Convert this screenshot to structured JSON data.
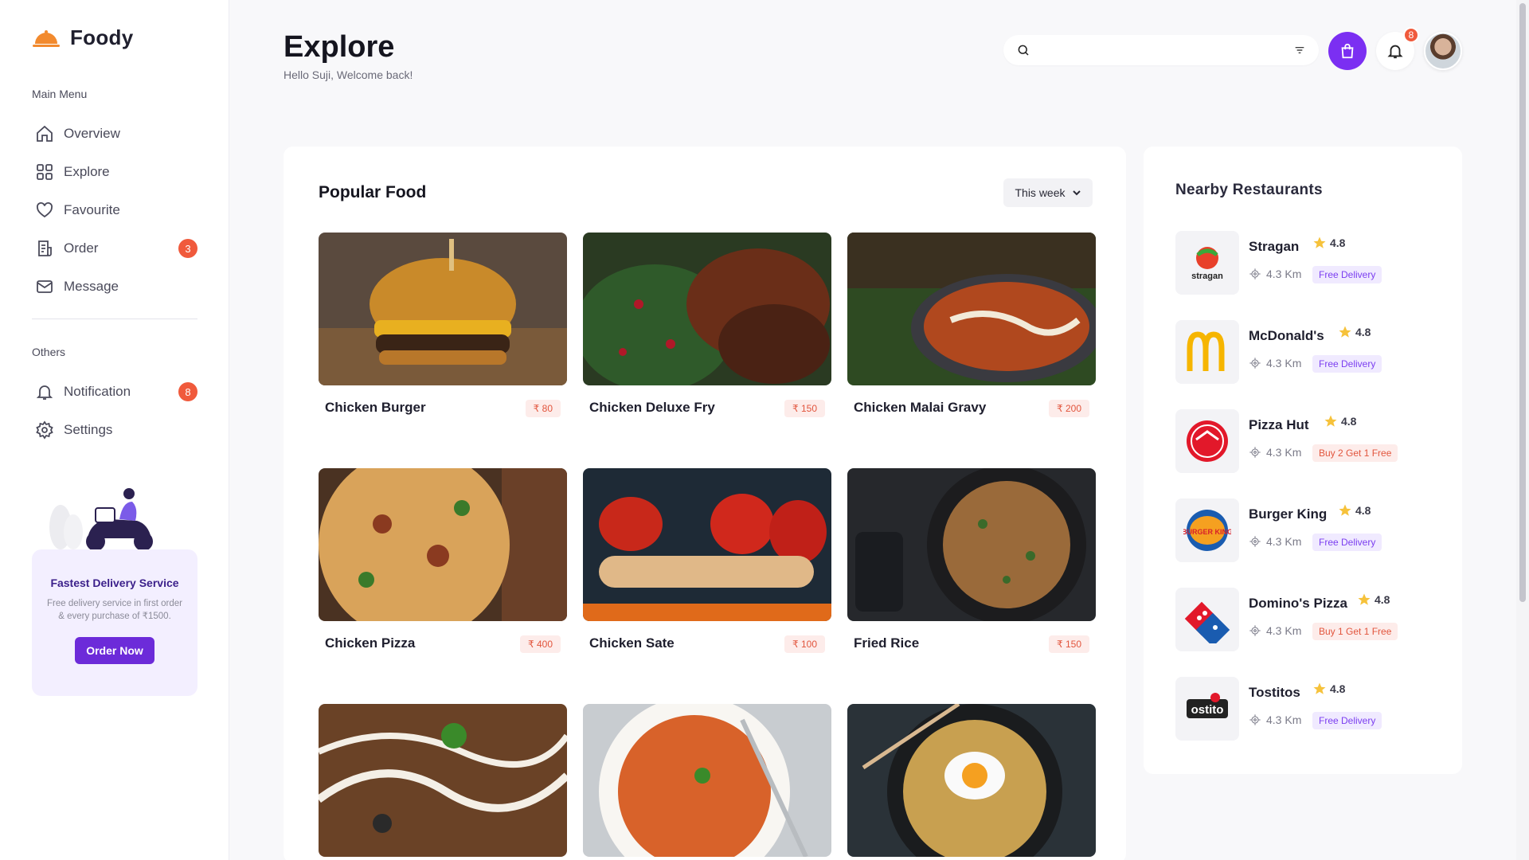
{
  "app": {
    "name": "Foody"
  },
  "sidebar": {
    "main_menu_label": "Main Menu",
    "main_items": [
      {
        "label": "Overview",
        "icon": "home-icon"
      },
      {
        "label": "Explore",
        "icon": "grid-icon"
      },
      {
        "label": "Favourite",
        "icon": "heart-icon"
      },
      {
        "label": "Order",
        "icon": "receipt-icon",
        "badge": "3"
      },
      {
        "label": "Message",
        "icon": "mail-icon"
      }
    ],
    "others_label": "Others",
    "other_items": [
      {
        "label": "Notification",
        "icon": "bell-icon",
        "badge": "8"
      },
      {
        "label": "Settings",
        "icon": "gear-icon"
      }
    ],
    "promo": {
      "title": "Fastest Delivery Service",
      "text": "Free delivery service in first order & every purchase of ₹1500.",
      "button": "Order Now"
    }
  },
  "header": {
    "title": "Explore",
    "subtitle": "Hello Suji, Welcome back!",
    "search_placeholder": "",
    "notification_count": "8"
  },
  "popular": {
    "title": "Popular Food",
    "period": "This week",
    "items": [
      {
        "name": "Chicken Burger",
        "price": "₹ 80"
      },
      {
        "name": "Chicken Deluxe Fry",
        "price": "₹ 150"
      },
      {
        "name": "Chicken Malai Gravy",
        "price": "₹ 200"
      },
      {
        "name": "Chicken Pizza",
        "price": "₹ 400"
      },
      {
        "name": "Chicken Sate",
        "price": "₹ 100"
      },
      {
        "name": "Fried Rice",
        "price": "₹ 150"
      },
      {
        "name": "",
        "price": ""
      },
      {
        "name": "",
        "price": ""
      },
      {
        "name": "",
        "price": ""
      }
    ]
  },
  "nearby": {
    "title": "Nearby Restaurants",
    "restaurants": [
      {
        "name": "Stragan",
        "rating": "4.8",
        "distance": "4.3 Km",
        "tag": "Free Delivery",
        "tag_type": "free"
      },
      {
        "name": "McDonald's",
        "rating": "4.8",
        "distance": "4.3 Km",
        "tag": "Free Delivery",
        "tag_type": "free"
      },
      {
        "name": "Pizza Hut",
        "rating": "4.8",
        "distance": "4.3 Km",
        "tag": "Buy 2 Get 1 Free",
        "tag_type": "deal"
      },
      {
        "name": "Burger King",
        "rating": "4.8",
        "distance": "4.3 Km",
        "tag": "Free Delivery",
        "tag_type": "free"
      },
      {
        "name": "Domino's Pizza",
        "rating": "4.8",
        "distance": "4.3 Km",
        "tag": "Buy 1 Get 1 Free",
        "tag_type": "deal"
      },
      {
        "name": "Tostitos",
        "rating": "4.8",
        "distance": "4.3 Km",
        "tag": "Free Delivery",
        "tag_type": "free"
      }
    ],
    "logo_text": {
      "stragan": "stragan",
      "burger_king": "BURGER KING",
      "dominos": "Domino's Pizza",
      "tostitos": "ostito"
    }
  },
  "colors": {
    "accent": "#7b2ff2",
    "badge": "#f05a3c",
    "price_bg": "#fdecea",
    "price_text": "#e2553d"
  }
}
